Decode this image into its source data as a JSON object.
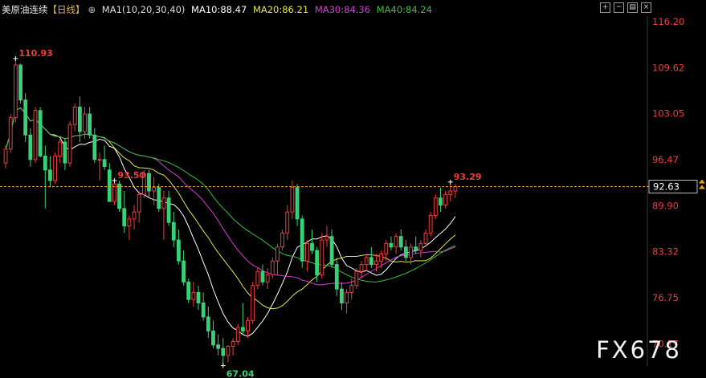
{
  "header": {
    "symbol": "美原油连续",
    "period": "【日线】",
    "indicator": "MA1(10,20,30,40)",
    "ma10": "MA10:88.47",
    "ma20": "MA20:86.21",
    "ma30": "MA30:84.36",
    "ma40": "MA40:84.24"
  },
  "watermark": "FX678",
  "colors": {
    "up": "#f03c3c",
    "down": "#3ad07a",
    "ma10": "#ffffff",
    "ma20": "#e6e64b",
    "ma30": "#d43cd4",
    "ma40": "#3cbe3c",
    "price_line": "#e8a020",
    "background": "#000000"
  },
  "chart_data": {
    "type": "candlestick",
    "ylim": [
      67.0,
      117.0
    ],
    "yticks": [
      "116.20",
      "109.62",
      "103.05",
      "96.47",
      "89.90",
      "83.32",
      "76.75",
      "70.17"
    ],
    "current_price": "92.63",
    "annotations": {
      "high": "110.93",
      "mid_high": "93.50",
      "right_high": "93.29",
      "low": "67.04"
    },
    "candles": [
      [
        96.0,
        98.5,
        95.2,
        98.0
      ],
      [
        98.0,
        103.0,
        97.5,
        102.5
      ],
      [
        102.5,
        110.93,
        101.8,
        110.0
      ],
      [
        110.0,
        110.2,
        104.5,
        105.0
      ],
      [
        105.0,
        106.0,
        99.0,
        100.0
      ],
      [
        100.0,
        101.0,
        95.5,
        96.5
      ],
      [
        96.5,
        104.0,
        96.0,
        103.5
      ],
      [
        103.5,
        104.0,
        96.8,
        97.0
      ],
      [
        97.0,
        98.5,
        89.5,
        95.0
      ],
      [
        95.0,
        97.0,
        92.5,
        93.5
      ],
      [
        93.5,
        97.5,
        93.0,
        97.0
      ],
      [
        97.0,
        99.5,
        96.0,
        99.0
      ],
      [
        99.0,
        99.5,
        95.0,
        96.0
      ],
      [
        96.0,
        102.0,
        95.5,
        101.5
      ],
      [
        101.5,
        104.5,
        100.5,
        104.0
      ],
      [
        104.0,
        105.5,
        99.0,
        100.5
      ],
      [
        100.5,
        104.0,
        99.5,
        103.0
      ],
      [
        103.0,
        104.0,
        99.5,
        100.0
      ],
      [
        100.0,
        101.0,
        96.0,
        96.5
      ],
      [
        96.5,
        97.5,
        93.5,
        96.5
      ],
      [
        96.5,
        98.5,
        95.0,
        95.5
      ],
      [
        95.0,
        96.0,
        90.5,
        90.5
      ],
      [
        90.5,
        93.5,
        90.0,
        93.0
      ],
      [
        93.0,
        93.5,
        89.0,
        89.5
      ],
      [
        89.5,
        92.0,
        86.0,
        87.0
      ],
      [
        87.0,
        88.5,
        85.0,
        88.0
      ],
      [
        88.0,
        90.0,
        86.5,
        89.0
      ],
      [
        89.0,
        92.0,
        87.5,
        91.5
      ],
      [
        91.5,
        95.0,
        91.0,
        94.5
      ],
      [
        94.5,
        95.0,
        91.0,
        92.0
      ],
      [
        92.0,
        94.0,
        90.0,
        92.5
      ],
      [
        92.5,
        93.0,
        89.0,
        89.5
      ],
      [
        89.5,
        92.0,
        85.0,
        91.0
      ],
      [
        91.0,
        92.0,
        87.0,
        87.5
      ],
      [
        87.5,
        89.0,
        84.0,
        85.0
      ],
      [
        85.0,
        86.5,
        81.5,
        82.0
      ],
      [
        82.0,
        83.5,
        78.5,
        79.0
      ],
      [
        79.0,
        79.5,
        76.0,
        76.5
      ],
      [
        76.5,
        79.0,
        75.5,
        77.5
      ],
      [
        77.5,
        78.5,
        75.0,
        76.0
      ],
      [
        76.0,
        77.5,
        73.5,
        74.0
      ],
      [
        74.0,
        75.5,
        71.0,
        72.0
      ],
      [
        72.0,
        73.5,
        69.5,
        70.0
      ],
      [
        70.0,
        71.5,
        68.5,
        69.5
      ],
      [
        69.5,
        71.0,
        67.04,
        68.5
      ],
      [
        68.5,
        70.0,
        67.5,
        69.8
      ],
      [
        69.8,
        71.0,
        68.5,
        70.5
      ],
      [
        70.5,
        73.0,
        70.0,
        72.5
      ],
      [
        72.5,
        76.0,
        71.5,
        72.0
      ],
      [
        72.0,
        74.0,
        71.0,
        73.5
      ],
      [
        73.5,
        79.0,
        73.0,
        78.5
      ],
      [
        78.5,
        81.0,
        78.0,
        80.5
      ],
      [
        80.5,
        81.5,
        78.5,
        79.0
      ],
      [
        79.0,
        81.0,
        78.0,
        80.0
      ],
      [
        80.0,
        82.5,
        79.5,
        82.0
      ],
      [
        82.0,
        84.5,
        80.0,
        84.0
      ],
      [
        84.0,
        86.5,
        83.5,
        86.0
      ],
      [
        86.0,
        90.0,
        85.0,
        89.0
      ],
      [
        89.0,
        93.5,
        88.0,
        92.5
      ],
      [
        92.5,
        93.0,
        87.0,
        88.0
      ],
      [
        88.0,
        88.5,
        81.0,
        82.0
      ],
      [
        82.0,
        85.0,
        80.5,
        84.5
      ],
      [
        84.5,
        86.5,
        83.0,
        83.5
      ],
      [
        83.5,
        84.0,
        79.0,
        80.0
      ],
      [
        80.0,
        86.0,
        79.5,
        85.0
      ],
      [
        85.0,
        87.0,
        84.0,
        85.5
      ],
      [
        85.5,
        86.5,
        81.0,
        81.5
      ],
      [
        81.5,
        82.5,
        77.0,
        78.0
      ],
      [
        78.0,
        79.0,
        75.0,
        76.0
      ],
      [
        76.0,
        78.0,
        74.5,
        77.5
      ],
      [
        77.5,
        79.5,
        76.5,
        78.5
      ],
      [
        78.5,
        81.0,
        78.0,
        80.5
      ],
      [
        80.5,
        82.0,
        79.5,
        81.5
      ],
      [
        81.5,
        83.0,
        80.5,
        82.5
      ],
      [
        82.5,
        84.0,
        81.0,
        81.5
      ],
      [
        81.5,
        83.0,
        80.5,
        82.0
      ],
      [
        82.0,
        83.5,
        81.0,
        83.0
      ],
      [
        83.0,
        85.0,
        82.0,
        84.5
      ],
      [
        84.5,
        85.5,
        83.5,
        84.0
      ],
      [
        84.0,
        86.0,
        83.0,
        85.5
      ],
      [
        85.5,
        86.5,
        83.5,
        84.0
      ],
      [
        84.0,
        85.0,
        82.0,
        82.5
      ],
      [
        82.5,
        84.5,
        81.5,
        84.0
      ],
      [
        84.0,
        85.5,
        83.0,
        83.5
      ],
      [
        83.5,
        85.0,
        82.5,
        84.5
      ],
      [
        84.5,
        86.5,
        84.0,
        86.0
      ],
      [
        86.0,
        89.0,
        85.5,
        88.5
      ],
      [
        88.5,
        91.5,
        88.0,
        91.0
      ],
      [
        91.0,
        92.5,
        89.0,
        90.0
      ],
      [
        90.0,
        92.0,
        89.5,
        91.5
      ],
      [
        91.5,
        93.29,
        90.5,
        92.0
      ],
      [
        92.0,
        93.0,
        91.0,
        92.63
      ]
    ]
  }
}
